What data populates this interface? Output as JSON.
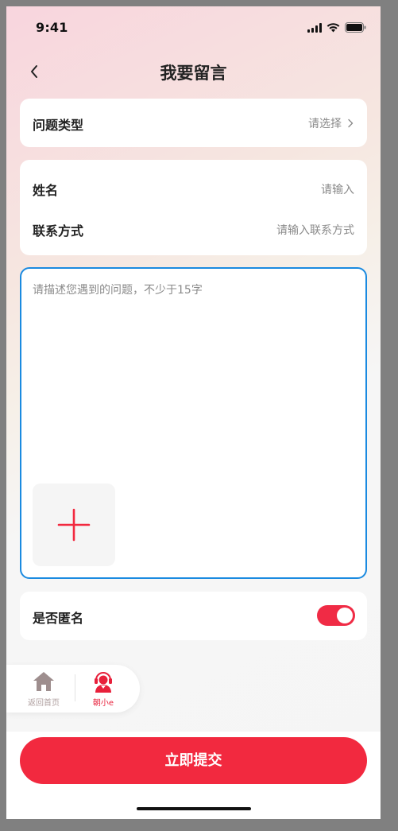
{
  "status_bar": {
    "time": "9:41"
  },
  "header": {
    "title": "我要留言"
  },
  "question_type": {
    "label": "问题类型",
    "value": "请选择",
    "chevron": "chevron-right-icon"
  },
  "contact": {
    "name_label": "姓名",
    "name_placeholder": "请输入",
    "contact_label": "联系方式",
    "contact_placeholder": "请输入联系方式"
  },
  "description": {
    "placeholder": "请描述您遇到的问题，不少于15字"
  },
  "upload": {
    "icon": "plus-icon"
  },
  "anonymous": {
    "label": "是否匿名",
    "enabled": true
  },
  "floating_nav": {
    "home_label": "返回首页",
    "assistant_label": "朝小e"
  },
  "footer": {
    "submit_label": "立即提交"
  },
  "colors": {
    "accent": "#f2293f",
    "focus_border": "#1a8ae0",
    "toggle_on": "#f02b45"
  }
}
